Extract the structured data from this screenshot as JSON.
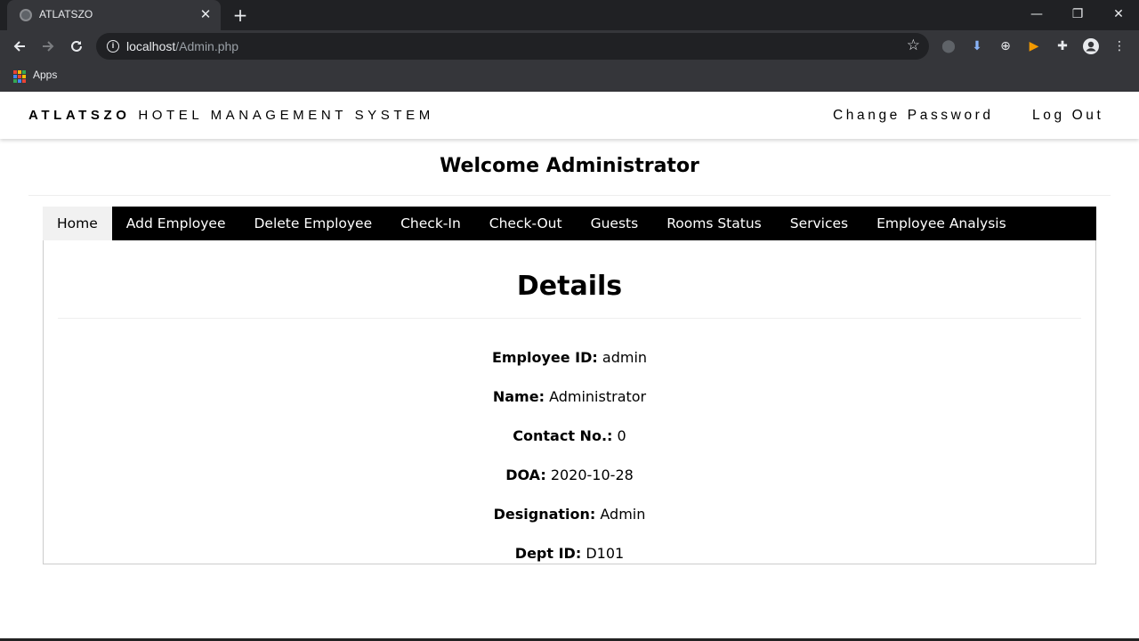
{
  "browser": {
    "tab_title": "ATLATSZO",
    "tab_close": "✕",
    "new_tab": "+",
    "url_host": "localhost",
    "url_path": "/Admin.php",
    "bookmarks_apps": "Apps",
    "window_minimize": "—",
    "window_restore": "❐",
    "window_close": "✕"
  },
  "header": {
    "brand_bold": "ATLATSZO",
    "brand_rest": "HOTEL MANAGEMENT SYSTEM",
    "change_password": "Change Password",
    "log_out": "Log Out"
  },
  "welcome": "Welcome Administrator",
  "menu": {
    "items": [
      "Home",
      "Add Employee",
      "Delete Employee",
      "Check-In",
      "Check-Out",
      "Guests",
      "Rooms Status",
      "Services",
      "Employee Analysis"
    ],
    "active_index": 0
  },
  "details": {
    "title": "Details",
    "fields": [
      {
        "label": "Employee ID:",
        "value": "admin"
      },
      {
        "label": "Name:",
        "value": "Administrator"
      },
      {
        "label": "Contact No.:",
        "value": "0"
      },
      {
        "label": "DOA:",
        "value": "2020-10-28"
      },
      {
        "label": "Designation:",
        "value": "Admin"
      },
      {
        "label": "Dept ID:",
        "value": "D101"
      }
    ]
  },
  "icons": [
    "globe-icon",
    "back-arrow-icon",
    "forward-arrow-icon",
    "reload-icon",
    "info-icon",
    "star-icon",
    "apps-grid-icon",
    "extensions-icon",
    "profile-icon",
    "menu-kebab-icon"
  ],
  "colors": {
    "menu_bg": "#000000",
    "menu_active_bg": "#f1f1f1",
    "apps_grid": [
      "#ea4335",
      "#fbbc05",
      "#34a853",
      "#4285f4",
      "#ea4335",
      "#fbbc05",
      "#34a853",
      "#4285f4",
      "#ea4335"
    ]
  }
}
